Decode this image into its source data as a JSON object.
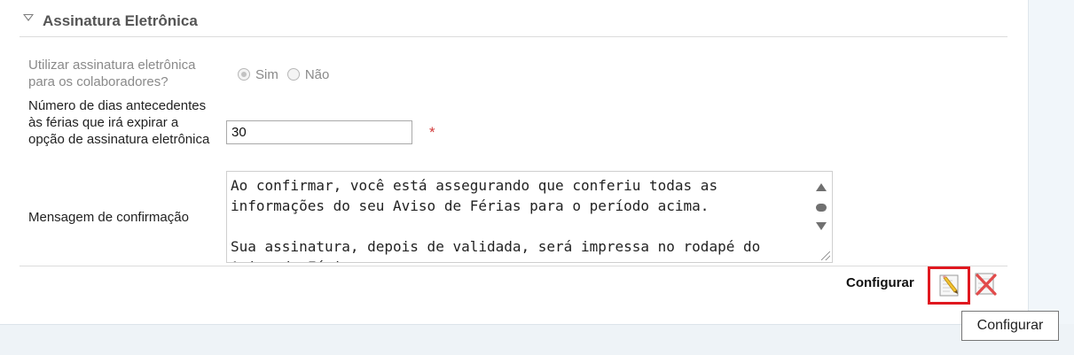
{
  "section": {
    "title": "Assinatura Eletrônica"
  },
  "form": {
    "use_signature": {
      "label": "Utilizar assinatura eletrônica para os colaboradores?",
      "options": [
        "Sim",
        "Não"
      ],
      "selected": "Sim"
    },
    "days": {
      "label": "Número de dias antecedentes às férias que irá expirar a opção de assinatura eletrônica",
      "value": "30",
      "required_mark": "*"
    },
    "confirmation_message": {
      "label": "Mensagem de confirmação",
      "value": "Ao confirmar, você está assegurando que conferiu todas as informações do seu Aviso de Férias para o período acima.\n\nSua assinatura, depois de validada, será impressa no rodapé do Aviso de Férias."
    }
  },
  "footer": {
    "configure_label": "Configurar",
    "tooltip": "Configurar"
  },
  "icons": {
    "section_toggle": "triangle-down-icon",
    "edit": "pencil-page-icon",
    "delete": "red-x-icon"
  },
  "colors": {
    "required": "#d23b3b",
    "highlight_border": "#e0181f"
  }
}
